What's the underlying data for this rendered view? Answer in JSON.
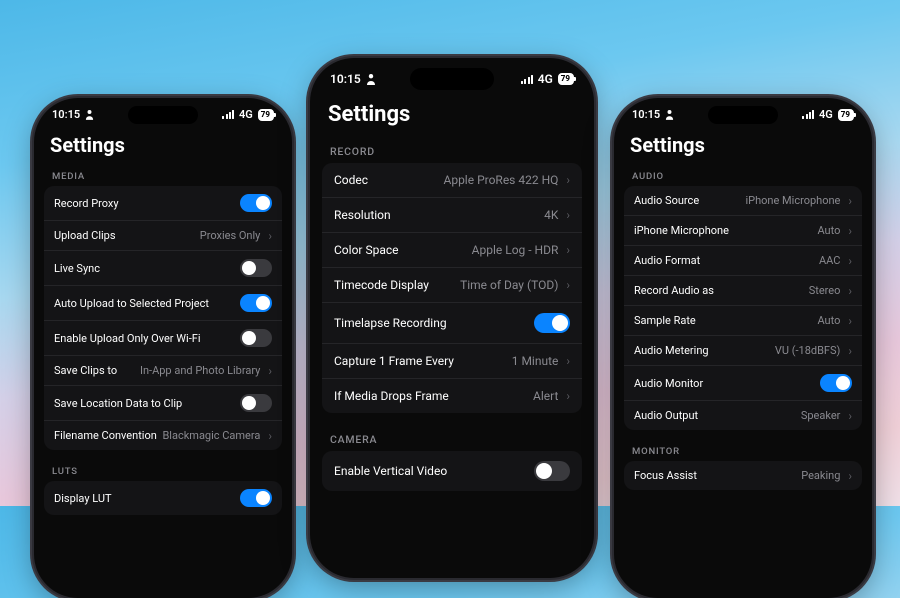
{
  "statusbar": {
    "time": "10:15",
    "network": "4G",
    "battery": "79"
  },
  "title": "Settings",
  "left": {
    "sections": {
      "media": "MEDIA",
      "luts": "LUTS"
    },
    "rows": {
      "record_proxy": "Record Proxy",
      "upload_clips": {
        "label": "Upload Clips",
        "value": "Proxies Only"
      },
      "live_sync": "Live Sync",
      "auto_upload": "Auto Upload to Selected Project",
      "wifi_only": "Enable Upload Only Over Wi-Fi",
      "save_clips": {
        "label": "Save Clips to",
        "value": "In-App and Photo Library"
      },
      "save_location": "Save Location Data to Clip",
      "filename": {
        "label": "Filename Convention",
        "value": "Blackmagic Camera"
      },
      "display_lut": "Display LUT"
    }
  },
  "center": {
    "sections": {
      "record": "RECORD",
      "camera": "CAMERA"
    },
    "rows": {
      "codec": {
        "label": "Codec",
        "value": "Apple ProRes 422 HQ"
      },
      "resolution": {
        "label": "Resolution",
        "value": "4K"
      },
      "color_space": {
        "label": "Color Space",
        "value": "Apple Log - HDR"
      },
      "timecode": {
        "label": "Timecode Display",
        "value": "Time of Day (TOD)"
      },
      "timelapse": "Timelapse Recording",
      "capture_every": {
        "label": "Capture 1 Frame Every",
        "value": "1 Minute"
      },
      "drops": {
        "label": "If Media Drops Frame",
        "value": "Alert"
      },
      "vertical": "Enable Vertical Video"
    }
  },
  "right": {
    "sections": {
      "audio": "AUDIO",
      "monitor": "MONITOR"
    },
    "rows": {
      "audio_source": {
        "label": "Audio Source",
        "value": "iPhone Microphone"
      },
      "iphone_mic": {
        "label": "iPhone Microphone",
        "value": "Auto"
      },
      "audio_format": {
        "label": "Audio Format",
        "value": "AAC"
      },
      "record_as": {
        "label": "Record Audio as",
        "value": "Stereo"
      },
      "sample_rate": {
        "label": "Sample Rate",
        "value": "Auto"
      },
      "metering": {
        "label": "Audio Metering",
        "value": "VU (-18dBFS)"
      },
      "monitor": "Audio Monitor",
      "output": {
        "label": "Audio Output",
        "value": "Speaker"
      },
      "focus_assist": {
        "label": "Focus Assist",
        "value": "Peaking"
      }
    }
  }
}
